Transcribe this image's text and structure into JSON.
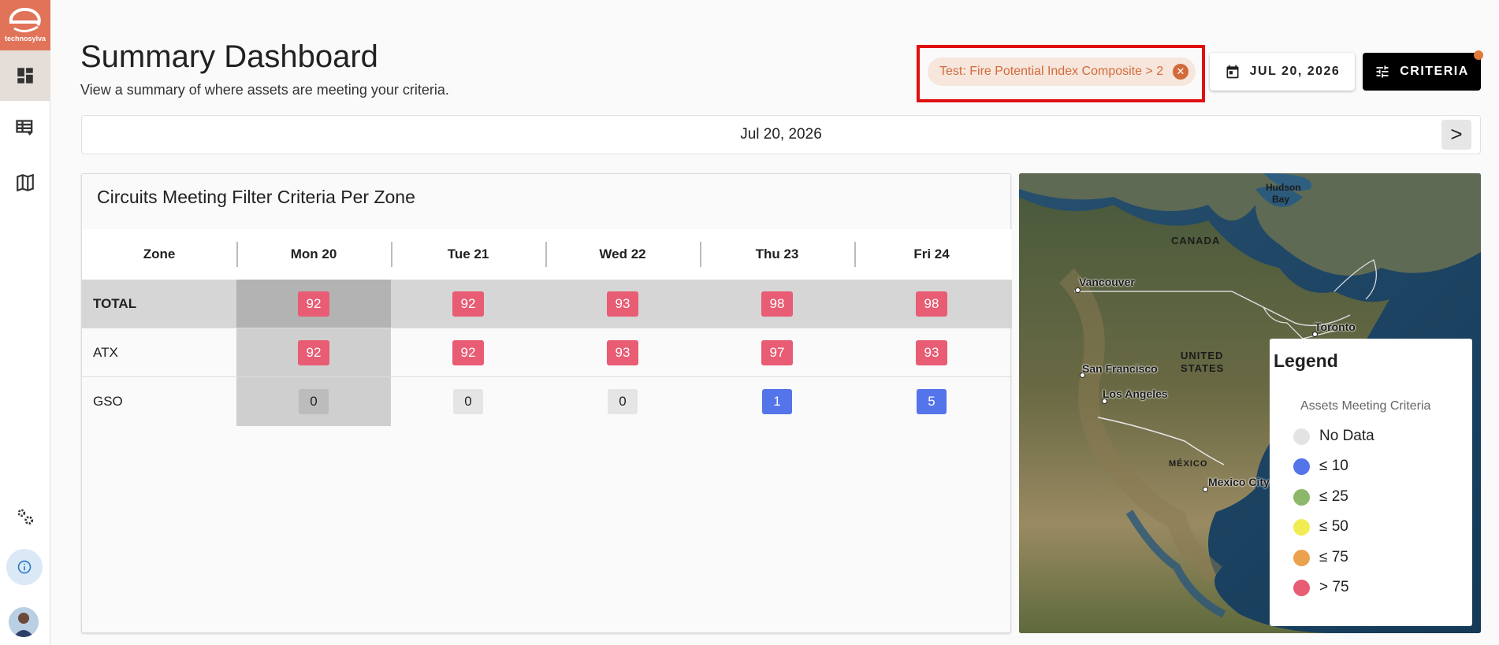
{
  "brand": {
    "name": "technosylva"
  },
  "header": {
    "title": "Summary Dashboard",
    "subtitle": "View a summary of where assets are meeting your criteria.",
    "filter_chip": "Test: Fire Potential Index Composite > 2",
    "date_button": "JUL 20, 2026",
    "criteria_button": "CRITERIA"
  },
  "date_bar": {
    "label": "Jul 20, 2026",
    "next": ">"
  },
  "table": {
    "title": "Circuits Meeting Filter Criteria Per Zone",
    "columns": [
      "Zone",
      "Mon 20",
      "Tue 21",
      "Wed 22",
      "Thu 23",
      "Fri 24"
    ],
    "rows": [
      {
        "zone": "TOTAL",
        "values": [
          "92",
          "92",
          "93",
          "98",
          "98"
        ]
      },
      {
        "zone": "ATX",
        "values": [
          "92",
          "92",
          "93",
          "97",
          "93"
        ]
      },
      {
        "zone": "GSO",
        "values": [
          "0",
          "0",
          "0",
          "1",
          "5"
        ]
      }
    ]
  },
  "map": {
    "labels": {
      "hudson": "Hudson",
      "bay": "Bay",
      "canada": "CANADA",
      "united": "UNITED",
      "states": "STATES",
      "mexico": "MÉXICO"
    },
    "cities": {
      "vancouver": "Vancouver",
      "toronto": "Toronto",
      "sf": "San Francisco",
      "la": "Los Angeles",
      "mexico_city": "Mexico City"
    }
  },
  "legend": {
    "title": "Legend",
    "subtitle": "Assets Meeting Criteria",
    "items": [
      {
        "label": "No Data",
        "color": "#e3e3e3"
      },
      {
        "label": "≤ 10",
        "color": "#5474ea"
      },
      {
        "label": "≤ 25",
        "color": "#8db86a"
      },
      {
        "label": "≤ 50",
        "color": "#f2ec54"
      },
      {
        "label": "≤ 75",
        "color": "#eba24e"
      },
      {
        "label": "> 75",
        "color": "#e85c74"
      }
    ]
  },
  "colors": {
    "accent": "#e07358",
    "chip_text": "#d36a3a",
    "badge_high": "#e85c74",
    "badge_low": "#5474ea"
  },
  "icons": {
    "nav": [
      "dashboard-icon",
      "table-filter-icon",
      "map-icon",
      "settings-icon",
      "info-icon"
    ],
    "date": "calendar-icon",
    "criteria": "tune-icon"
  }
}
